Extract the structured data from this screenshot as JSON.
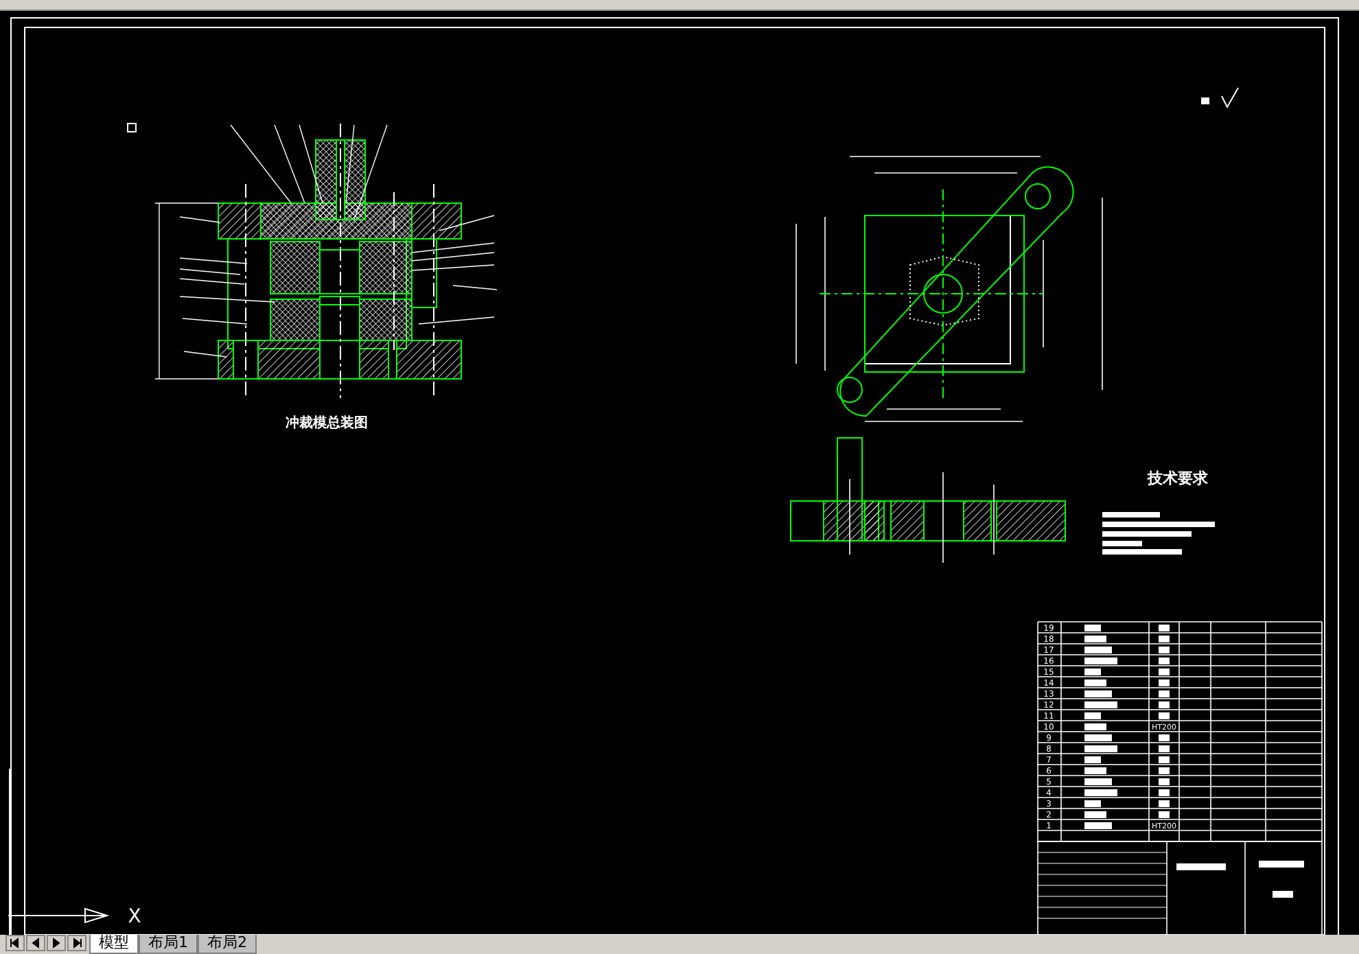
{
  "drawing": {
    "assembly_title": "冲裁模总装图",
    "tech_requirements_title": "技术要求",
    "parts_list": {
      "rows": [
        {
          "no": "19"
        },
        {
          "no": "18"
        },
        {
          "no": "17"
        },
        {
          "no": "16"
        },
        {
          "no": "15"
        },
        {
          "no": "14"
        },
        {
          "no": "13"
        },
        {
          "no": "12"
        },
        {
          "no": "11"
        },
        {
          "no": "10",
          "material": "HT200"
        },
        {
          "no": "9"
        },
        {
          "no": "8"
        },
        {
          "no": "7"
        },
        {
          "no": "6"
        },
        {
          "no": "5"
        },
        {
          "no": "4"
        },
        {
          "no": "3"
        },
        {
          "no": "2"
        },
        {
          "no": "1",
          "material": "HT200"
        }
      ]
    }
  },
  "ucs": {
    "x_label": "X"
  },
  "layout_tabs": [
    {
      "label": "模型",
      "selected": true
    },
    {
      "label": "布局1",
      "selected": false
    },
    {
      "label": "布局2",
      "selected": false
    }
  ]
}
